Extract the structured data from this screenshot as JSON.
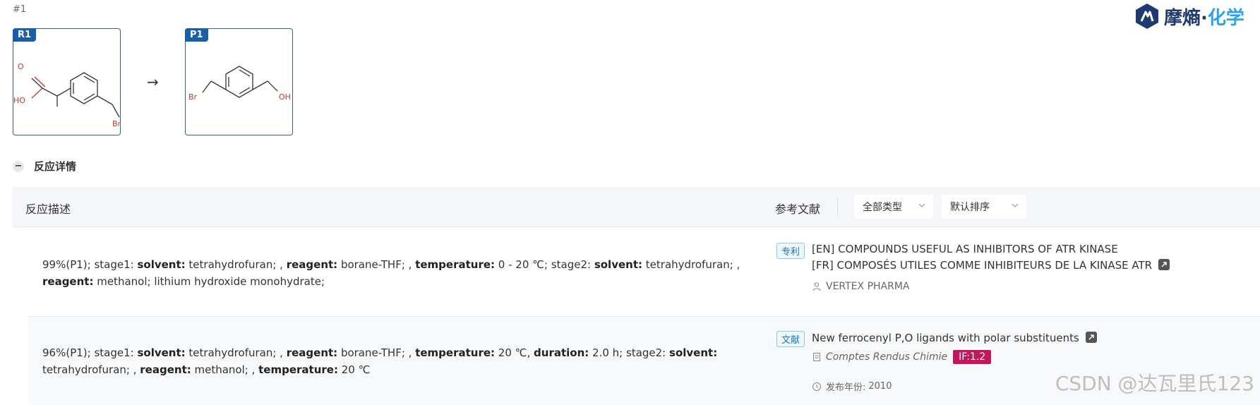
{
  "page": {
    "number": "#1"
  },
  "logo": {
    "brand_main": "摩熵",
    "brand_sep": "·",
    "brand_sub": "化学"
  },
  "reaction": {
    "reactant": {
      "tag": "R1",
      "atoms": {
        "o_top": "O",
        "ho": "HO",
        "br": "Br"
      }
    },
    "product": {
      "tag": "P1",
      "atoms": {
        "br": "Br",
        "oh": "OH"
      }
    },
    "arrow": "→"
  },
  "section": {
    "label": "反应详情",
    "toggle": "−"
  },
  "table": {
    "col_description": "反应描述",
    "col_reference": "参考文献",
    "type_select": "全部类型",
    "sort_select": "默认排序"
  },
  "rows": [
    {
      "description_parts": [
        {
          "t": "99%(P1); stage1: "
        },
        {
          "b": "solvent:"
        },
        {
          "t": " tetrahydrofuran; , "
        },
        {
          "b": "reagent:"
        },
        {
          "t": " borane-THF; , "
        },
        {
          "b": "temperature:"
        },
        {
          "t": " 0 - 20 ℃; stage2: "
        },
        {
          "b": "solvent:"
        },
        {
          "t": " tetrahydrofuran; , "
        },
        {
          "b": "reagent:"
        },
        {
          "t": " methanol; lithium hydroxide monohydrate;"
        }
      ],
      "ref_type": "专利",
      "title_en": "[EN] COMPOUNDS USEFUL AS INHIBITORS OF ATR KINASE",
      "title_fr": "[FR] COMPOSÉS UTILES COMME INHIBITEURS DE LA KINASE ATR",
      "assignee": "VERTEX PHARMA"
    },
    {
      "description_parts": [
        {
          "t": "96%(P1); stage1: "
        },
        {
          "b": "solvent:"
        },
        {
          "t": " tetrahydrofuran; , "
        },
        {
          "b": "reagent:"
        },
        {
          "t": " borane-THF; , "
        },
        {
          "b": "temperature:"
        },
        {
          "t": " 20 ℃, "
        },
        {
          "b": "duration:"
        },
        {
          "t": " 2.0 h; stage2: "
        },
        {
          "b": "solvent:"
        },
        {
          "t": " tetrahydrofuran; , "
        },
        {
          "b": "reagent:"
        },
        {
          "t": " methanol; , "
        },
        {
          "b": "temperature:"
        },
        {
          "t": " 20 ℃"
        }
      ],
      "ref_type": "文献",
      "title": "New ferrocenyl P,O ligands with polar substituents",
      "journal": "Comptes Rendus Chimie",
      "impact_factor": "IF:1.2",
      "year_label": "发布年份:",
      "year": "2010"
    }
  ],
  "watermark": "CSDN @达瓦里氏123",
  "colors": {
    "accent": "#1a5da8",
    "link_blue": "#1a78c2",
    "if_badge": "#c2185b"
  }
}
